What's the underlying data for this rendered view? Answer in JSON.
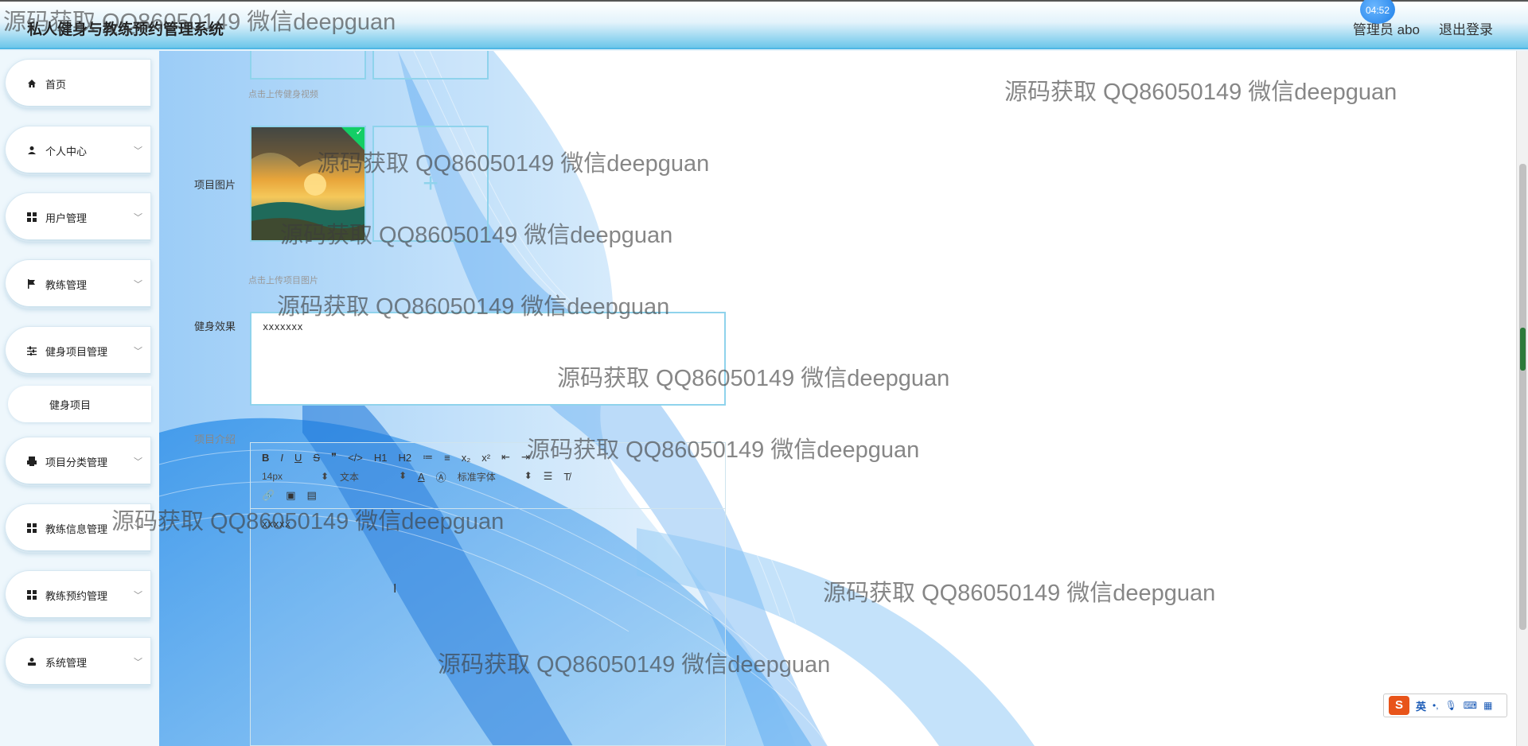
{
  "header": {
    "app_title": "私人健身与教练预约管理系统",
    "user_label": "管理员 abo",
    "logout_label": "退出登录",
    "clock": "04:52"
  },
  "sidebar": {
    "items": [
      {
        "label": "首页",
        "icon": "home-icon",
        "has_chevron": false
      },
      {
        "label": "个人中心",
        "icon": "person-icon",
        "has_chevron": true
      },
      {
        "label": "用户管理",
        "icon": "grid-icon",
        "has_chevron": true
      },
      {
        "label": "教练管理",
        "icon": "flag-icon",
        "has_chevron": true
      },
      {
        "label": "健身项目管理",
        "icon": "sliders-icon",
        "has_chevron": true
      },
      {
        "label": "项目分类管理",
        "icon": "printer-icon",
        "has_chevron": true
      },
      {
        "label": "教练信息管理",
        "icon": "grid-icon",
        "has_chevron": true
      },
      {
        "label": "教练预约管理",
        "icon": "grid-icon",
        "has_chevron": true
      },
      {
        "label": "系统管理",
        "icon": "user-icon",
        "has_chevron": true
      }
    ],
    "active_sub": "健身项目"
  },
  "form": {
    "video_hint": "点击上传健身视频",
    "image_label": "项目图片",
    "image_hint": "点击上传项目图片",
    "effect_label": "健身效果",
    "effect_value": "xxxxxxx",
    "intro_label": "项目介绍",
    "intro_value": "xxxxx"
  },
  "editor_toolbar": {
    "row1": [
      "B",
      "I",
      "U",
      "S",
      "❞",
      "</>",
      "H1",
      "H2",
      "≔",
      "≡",
      "x₂",
      "x²",
      "⇤",
      "⇥"
    ],
    "font_size": "14px",
    "text_style": "文本",
    "font_family": "标准字体",
    "row3": [
      "🔗",
      "▣",
      "▤"
    ]
  },
  "watermark_text": "源码获取 QQ86050149 微信deepguan",
  "ime": {
    "lang": "英"
  }
}
